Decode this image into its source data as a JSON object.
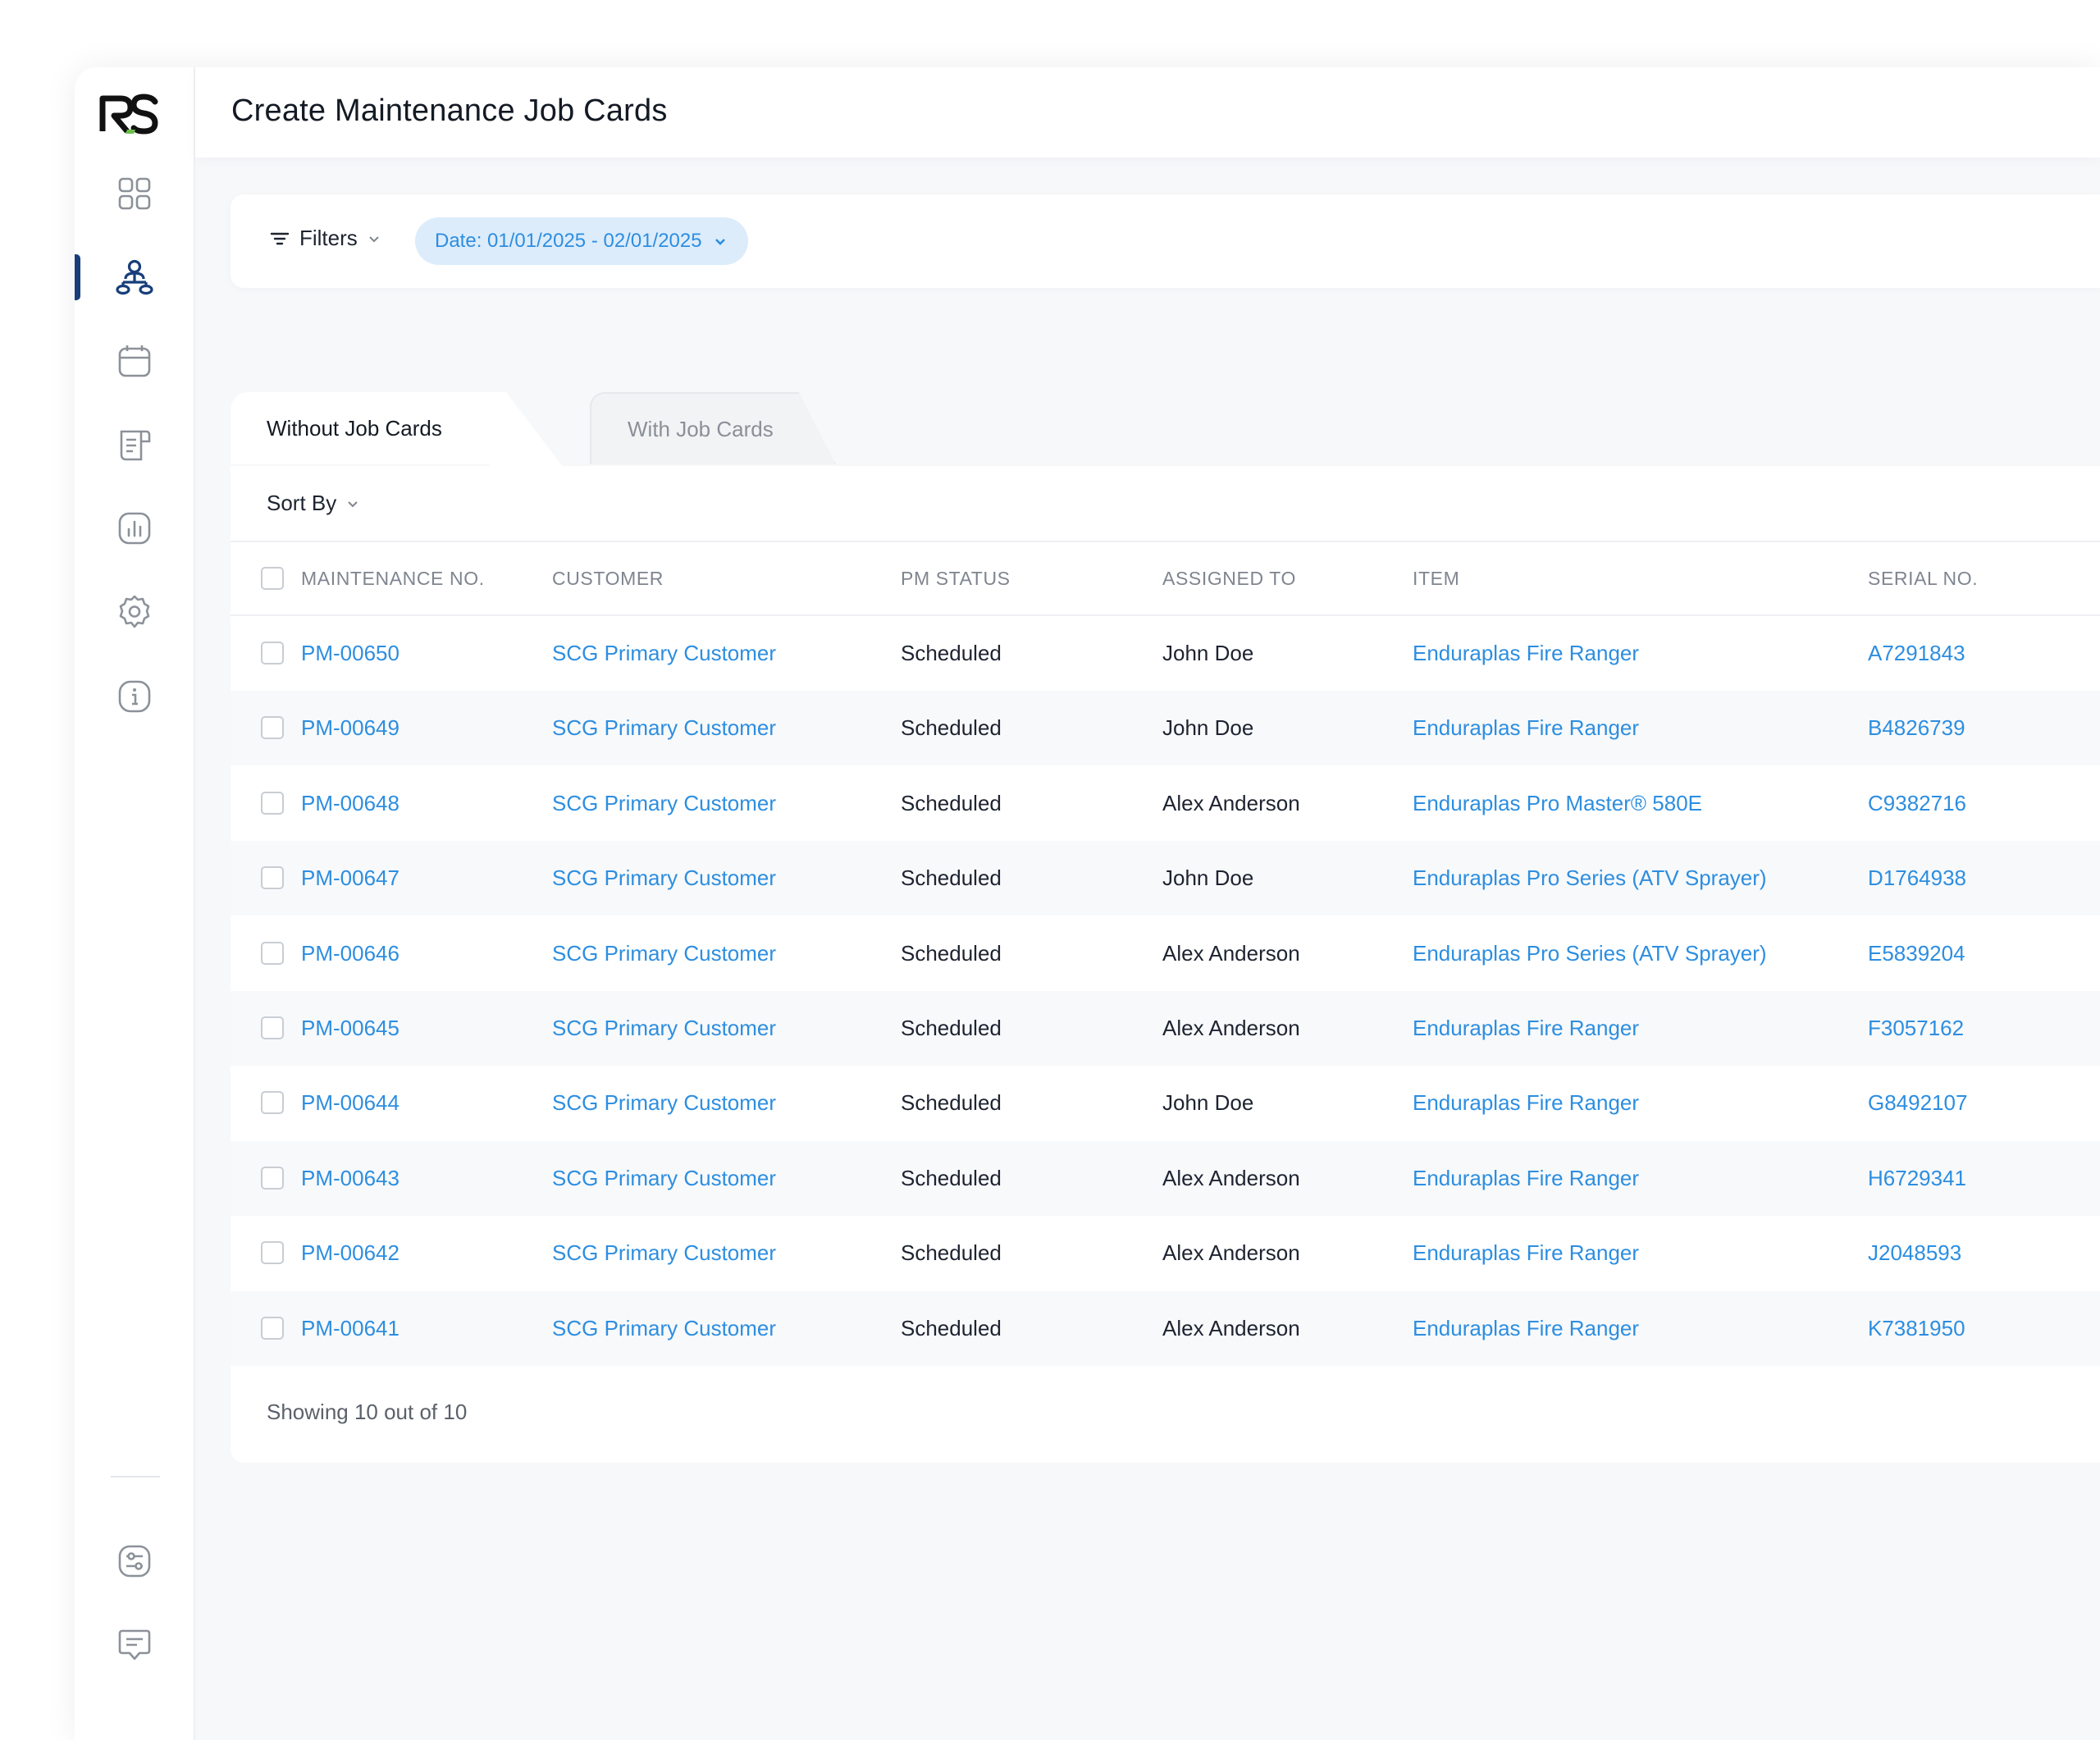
{
  "header": {
    "title": "Create Maintenance Job Cards"
  },
  "filters": {
    "filters_label": "Filters",
    "date_chip": "Date: 01/01/2025 - 02/01/2025"
  },
  "tabs": [
    {
      "label": "Without Job Cards",
      "active": true
    },
    {
      "label": "With Job Cards",
      "active": false
    }
  ],
  "sort": {
    "label": "Sort By"
  },
  "table": {
    "columns": [
      "MAINTENANCE NO.",
      "CUSTOMER",
      "PM STATUS",
      "ASSIGNED TO",
      "ITEM",
      "SERIAL NO."
    ],
    "rows": [
      {
        "no": "PM-00650",
        "customer": "SCG Primary Customer",
        "status": "Scheduled",
        "assigned": "John Doe",
        "item": "Enduraplas Fire Ranger",
        "serial": "A7291843"
      },
      {
        "no": "PM-00649",
        "customer": "SCG Primary Customer",
        "status": "Scheduled",
        "assigned": "John Doe",
        "item": "Enduraplas Fire Ranger",
        "serial": "B4826739"
      },
      {
        "no": "PM-00648",
        "customer": "SCG Primary Customer",
        "status": "Scheduled",
        "assigned": "Alex Anderson",
        "item": "Enduraplas Pro Master® 580E",
        "serial": "C9382716"
      },
      {
        "no": "PM-00647",
        "customer": "SCG Primary Customer",
        "status": "Scheduled",
        "assigned": "John Doe",
        "item": "Enduraplas Pro Series (ATV Sprayer)",
        "serial": "D1764938"
      },
      {
        "no": "PM-00646",
        "customer": "SCG Primary Customer",
        "status": "Scheduled",
        "assigned": "Alex Anderson",
        "item": "Enduraplas Pro Series (ATV Sprayer)",
        "serial": "E5839204"
      },
      {
        "no": "PM-00645",
        "customer": "SCG Primary Customer",
        "status": "Scheduled",
        "assigned": "Alex Anderson",
        "item": "Enduraplas Fire Ranger",
        "serial": "F3057162"
      },
      {
        "no": "PM-00644",
        "customer": "SCG Primary Customer",
        "status": "Scheduled",
        "assigned": "John Doe",
        "item": "Enduraplas Fire Ranger",
        "serial": "G8492107"
      },
      {
        "no": "PM-00643",
        "customer": "SCG Primary Customer",
        "status": "Scheduled",
        "assigned": "Alex Anderson",
        "item": "Enduraplas Fire Ranger",
        "serial": "H6729341"
      },
      {
        "no": "PM-00642",
        "customer": "SCG Primary Customer",
        "status": "Scheduled",
        "assigned": "Alex Anderson",
        "item": "Enduraplas Fire Ranger",
        "serial": "J2048593"
      },
      {
        "no": "PM-00641",
        "customer": "SCG Primary Customer",
        "status": "Scheduled",
        "assigned": "Alex Anderson",
        "item": "Enduraplas Fire Ranger",
        "serial": "K7381950"
      }
    ],
    "footer": "Showing 10 out of 10"
  },
  "sidebar": {
    "logo": "RS",
    "items": [
      {
        "icon": "dashboard-grid-icon",
        "active": false
      },
      {
        "icon": "org-hierarchy-icon",
        "active": true
      },
      {
        "icon": "calendar-icon",
        "active": false
      },
      {
        "icon": "document-icon",
        "active": false
      },
      {
        "icon": "bar-chart-icon",
        "active": false
      },
      {
        "icon": "gear-icon",
        "active": false
      },
      {
        "icon": "info-icon",
        "active": false
      },
      {
        "icon": "sliders-icon",
        "active": false
      },
      {
        "icon": "chat-icon",
        "active": false
      }
    ]
  },
  "colors": {
    "accent": "#2d8ee0",
    "active_nav": "#173e7a",
    "logo_green": "#6cc04a",
    "chip_bg": "#dcecfb"
  }
}
